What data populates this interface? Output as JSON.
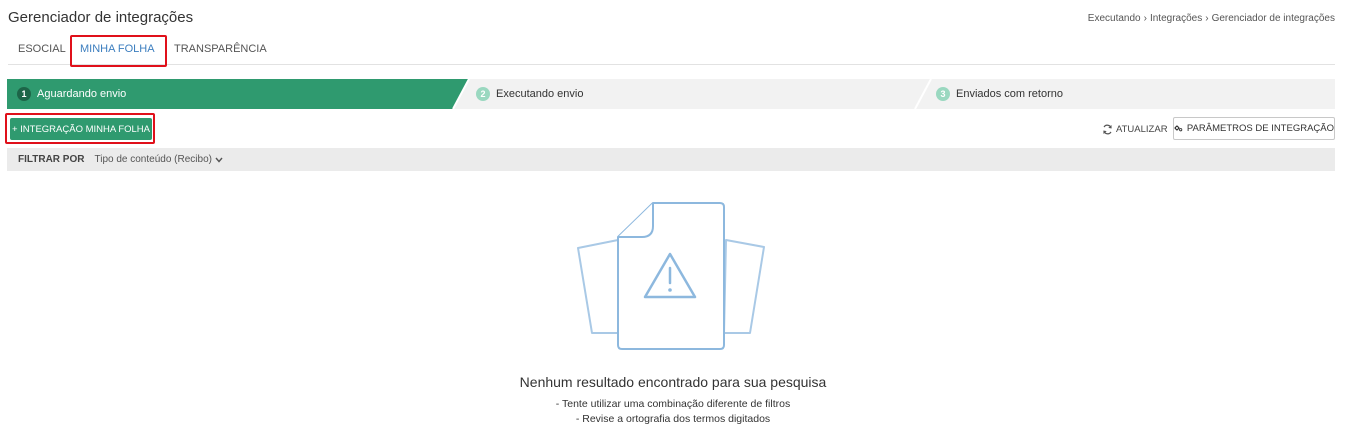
{
  "header": {
    "title": "Gerenciador de integrações",
    "breadcrumb": [
      "Executando",
      "Integrações",
      "Gerenciador de integrações"
    ]
  },
  "tabs": [
    {
      "label": "ESOCIAL",
      "active": false
    },
    {
      "label": "MINHA FOLHA",
      "active": true
    },
    {
      "label": "TRANSPARÊNCIA",
      "active": false
    }
  ],
  "steps": [
    {
      "number": "1",
      "label": "Aguardando envio",
      "active": true
    },
    {
      "number": "2",
      "label": "Executando envio",
      "active": false
    },
    {
      "number": "3",
      "label": "Enviados com retorno",
      "active": false
    }
  ],
  "toolbar": {
    "add_label": "+ INTEGRAÇÃO MINHA FOLHA",
    "refresh_label": "ATUALIZAR",
    "refresh_icon": "refresh-icon",
    "params_label": "PARÂMETROS DE INTEGRAÇÃO",
    "params_icon": "gears-icon"
  },
  "filter": {
    "label": "FILTRAR POR",
    "select_value": "Tipo de conteúdo (Recibo)",
    "chevron_icon": "chevron-down-icon"
  },
  "empty_state": {
    "icon": "document-warning-icon",
    "title": "Nenhum resultado encontrado para sua pesquisa",
    "hints": [
      "- Tente utilizar uma combinação diferente de filtros",
      "- Revise a ortografia dos termos digitados"
    ]
  },
  "colors": {
    "active_step": "#2f9a6f",
    "active_tab": "#3c7ebf",
    "highlight_box": "#e0101a",
    "illustration_stroke": "#8db8de"
  }
}
